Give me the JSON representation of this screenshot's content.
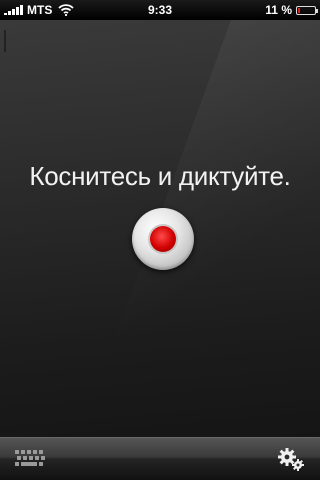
{
  "status_bar": {
    "carrier": "MTS",
    "time": "9:33",
    "battery_percent": "11 %",
    "battery_level": 0.11,
    "signal_bars": 5,
    "wifi_icon": "wifi-icon"
  },
  "main": {
    "prompt": "Коснитесь и диктуйте.",
    "record_icon": "record-icon"
  },
  "toolbar": {
    "keyboard_icon": "keyboard-icon",
    "settings_icon": "gears-icon"
  },
  "colors": {
    "record_red": "#d00000",
    "battery_low": "#dd2222"
  }
}
